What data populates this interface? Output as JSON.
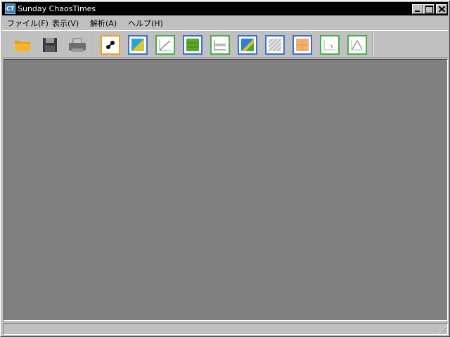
{
  "window": {
    "title": "Sunday ChaosTimes",
    "app_icon_text": "CT"
  },
  "menu": [
    {
      "label": "ファイル(F)"
    },
    {
      "label": "表示(V)"
    },
    {
      "label": "解析(A)"
    },
    {
      "label": "ヘルプ(H)"
    }
  ],
  "toolbar": {
    "file_buttons": [
      {
        "name": "open-icon"
      },
      {
        "name": "save-icon"
      },
      {
        "name": "print-icon"
      }
    ],
    "analysis_buttons": [
      {
        "name": "chaos-link-icon",
        "border": "#f0a020"
      },
      {
        "name": "attractor-blue-icon",
        "border": "#3a6fd8"
      },
      {
        "name": "line-plot-icon",
        "border": "#48b048"
      },
      {
        "name": "green-block-icon",
        "border": "#3a6fd8"
      },
      {
        "name": "spectrum-icon",
        "border": "#48b048"
      },
      {
        "name": "gradient-block-icon",
        "border": "#3a6fd8"
      },
      {
        "name": "hatched-block-icon",
        "border": "#3a6fd8"
      },
      {
        "name": "orange-block-icon",
        "border": "#3a6fd8"
      },
      {
        "name": "small-graph-icon",
        "border": "#48b048"
      },
      {
        "name": "peak-graph-icon",
        "border": "#48b048"
      }
    ]
  },
  "colors": {
    "titlebar": "#000000",
    "chrome": "#c0c0c0",
    "workspace": "#808080"
  }
}
